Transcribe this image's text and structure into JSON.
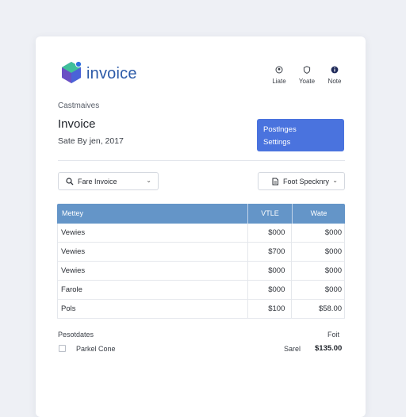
{
  "brand": {
    "name": "invoice"
  },
  "top_actions": [
    {
      "label": "Liate",
      "icon": "circle-user-icon"
    },
    {
      "label": "Yoate",
      "icon": "shield-icon"
    },
    {
      "label": "Note",
      "icon": "info-icon"
    }
  ],
  "header": {
    "section": "Castmaives",
    "title": "Invoice",
    "subtitle": "Sate By jen, 2017"
  },
  "settings_panel": {
    "line1": "Postlnges",
    "line2": "Settings"
  },
  "search": {
    "label": "Fare Invoice",
    "icon": "search-icon"
  },
  "sort": {
    "label": "Foot Specknry",
    "icon": "document-icon"
  },
  "table": {
    "columns": [
      "Mettey",
      "VTLE",
      "Wate"
    ],
    "rows": [
      [
        "Vewies",
        "$000",
        "$000"
      ],
      [
        "Vewies",
        "$700",
        "$000"
      ],
      [
        "Vewies",
        "$000",
        "$000"
      ],
      [
        "Farole",
        "$000",
        "$000"
      ],
      [
        "Pols",
        "$100",
        "$58.00"
      ]
    ]
  },
  "footer": {
    "label": "Pesotdates",
    "right_label": "Foit",
    "checkbox_label": "Parkel Cone",
    "total_label": "Sarel",
    "total_value": "$135.00"
  },
  "colors": {
    "accent": "#4a73de",
    "table_header": "#6495c8",
    "brand": "#2c5aa8"
  }
}
